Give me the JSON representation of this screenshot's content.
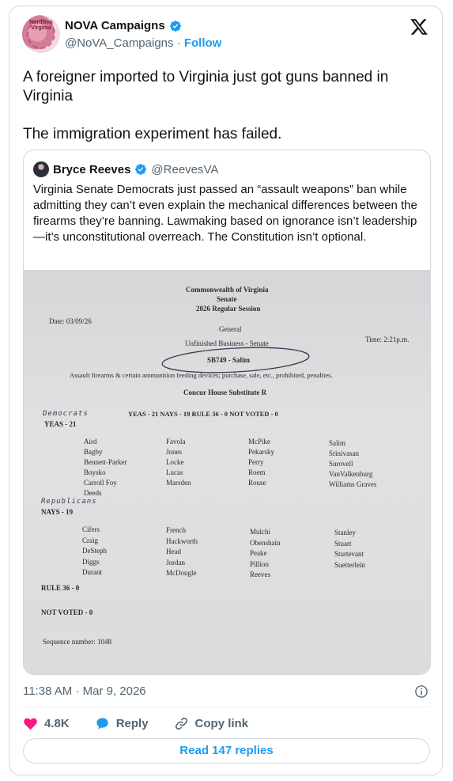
{
  "author": {
    "display_name": "NOVA Campaigns",
    "handle": "@NoVA_Campaigns",
    "separator": "·",
    "follow_label": "Follow",
    "avatar_text": "Northern Virginia"
  },
  "tweet": {
    "paragraphs": [
      "A foreigner imported to Virginia just got guns banned in Virginia",
      "The immigration experiment has failed."
    ],
    "timestamp": "11:38 AM · Mar 9, 2026"
  },
  "quoted": {
    "display_name": "Bryce Reeves",
    "handle": "@ReevesVA",
    "text": "Virginia Senate Democrats just passed an “assault weapons” ban while admitting they can’t even explain the mechanical differences between the firearms they’re banning. Lawmaking based on ignorance isn’t leadership—it’s unconstitutional overreach. The Constitution isn’t optional."
  },
  "document": {
    "header1": "Commonwealth of Virginia",
    "header2": "Senate",
    "header3": "2026 Regular Session",
    "date": "Date: 03/09/26",
    "general": "General",
    "unfinished": "Unfinished Business - Senate",
    "time": "Time: 2:21p.m.",
    "bill": "SB749 - Salim",
    "description": "Assault firearms & certain ammunition feeding devices; purchase, sale, etc., prohibited, penalties.",
    "motion": "Concur House Substitute R",
    "handwritten_dem": "Democrats",
    "tally": "YEAS - 21   NAYS - 19   RULE 36 - 0   NOT VOTED - 0",
    "yeas_label": "YEAS - 21",
    "yeas_columns": [
      [
        "Aird",
        "Bagby",
        "Bennett-Parker",
        "Boysko",
        "Carroll Foy",
        "Deeds"
      ],
      [
        "Favola",
        "Jones",
        "Locke",
        "Lucas",
        "Marsden"
      ],
      [
        "McPike",
        "Pekarsky",
        "Perry",
        "Roem",
        "Rouse"
      ],
      [
        "Salim",
        "Srinivasan",
        "Surovell",
        "VanValkenburg",
        "Williams Graves"
      ]
    ],
    "handwritten_rep": "Republicans",
    "nays_label": "NAYS - 19",
    "nays_columns": [
      [
        "Cifers",
        "Craig",
        "DeSteph",
        "Diggs",
        "Durant"
      ],
      [
        "French",
        "Hackworth",
        "Head",
        "Jordan",
        "McDougle"
      ],
      [
        "Mulchi",
        "Obenshain",
        "Peake",
        "Pillion",
        "Reeves"
      ],
      [
        "Stanley",
        "Stuart",
        "Sturtevant",
        "Suetterlein"
      ]
    ],
    "rule36": "RULE 36 - 0",
    "not_voted": "NOT VOTED - 0",
    "sequence": "Sequence number: 1048"
  },
  "actions": {
    "likes": "4.8K",
    "reply_label": "Reply",
    "copy_link_label": "Copy link",
    "read_replies_label": "Read 147 replies"
  },
  "colors": {
    "accent": "#1d9bf0",
    "like": "#f91880",
    "muted": "#536471",
    "border": "#cfd9de"
  },
  "icons": [
    "verified-badge-icon",
    "x-logo-icon",
    "info-icon",
    "heart-icon",
    "reply-bubble-icon",
    "link-icon"
  ]
}
